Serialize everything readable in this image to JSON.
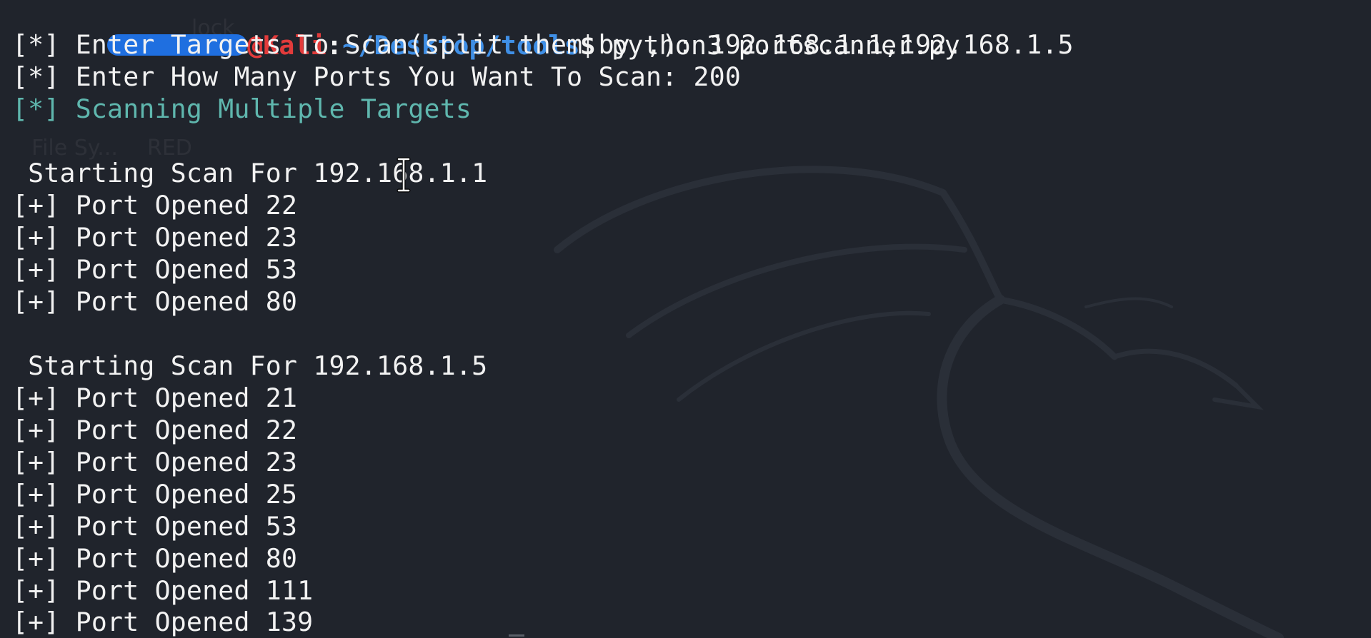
{
  "prompt": {
    "host": "@Kali",
    "sep": ":",
    "path": "~/Desktop/tools",
    "dollar": "$",
    "command": " python3 portscanner.py"
  },
  "lines": {
    "l1": "[*] Enter Targets To Scan(split them by ,): 192.168.1.1,192.168.1.5",
    "l2": "[*] Enter How Many Ports You Want To Scan: 200",
    "l3": "[*] Scanning Multiple Targets",
    "scan1": " Starting Scan For 192.168.1.1",
    "s1p1": "[+] Port Opened 22",
    "s1p2": "[+] Port Opened 23",
    "s1p3": "[+] Port Opened 53",
    "s1p4": "[+] Port Opened 80",
    "scan2": " Starting Scan For 192.168.1.5",
    "s2p1": "[+] Port Opened 21",
    "s2p2": "[+] Port Opened 22",
    "s2p3": "[+] Port Opened 23",
    "s2p4": "[+] Port Opened 25",
    "s2p5": "[+] Port Opened 53",
    "s2p6": "[+] Port Opened 80",
    "s2p7": "[+] Port Opened 111",
    "s2p8": "[+] Port Opened 139"
  },
  "ghost_desktop": {
    "label1": "File Sy...",
    "label2": "RED",
    "label3": "lock"
  },
  "colors": {
    "background": "#20242c",
    "text": "#f2f2f2",
    "accent_cyan": "#5fb7ae",
    "host_red": "#e23b3b",
    "path_blue": "#3f8fe6",
    "user_mask_blue": "#1f6fe0"
  },
  "icons": {
    "cursor": "text-cursor-icon",
    "wallpaper": "kali-dragon-icon"
  }
}
